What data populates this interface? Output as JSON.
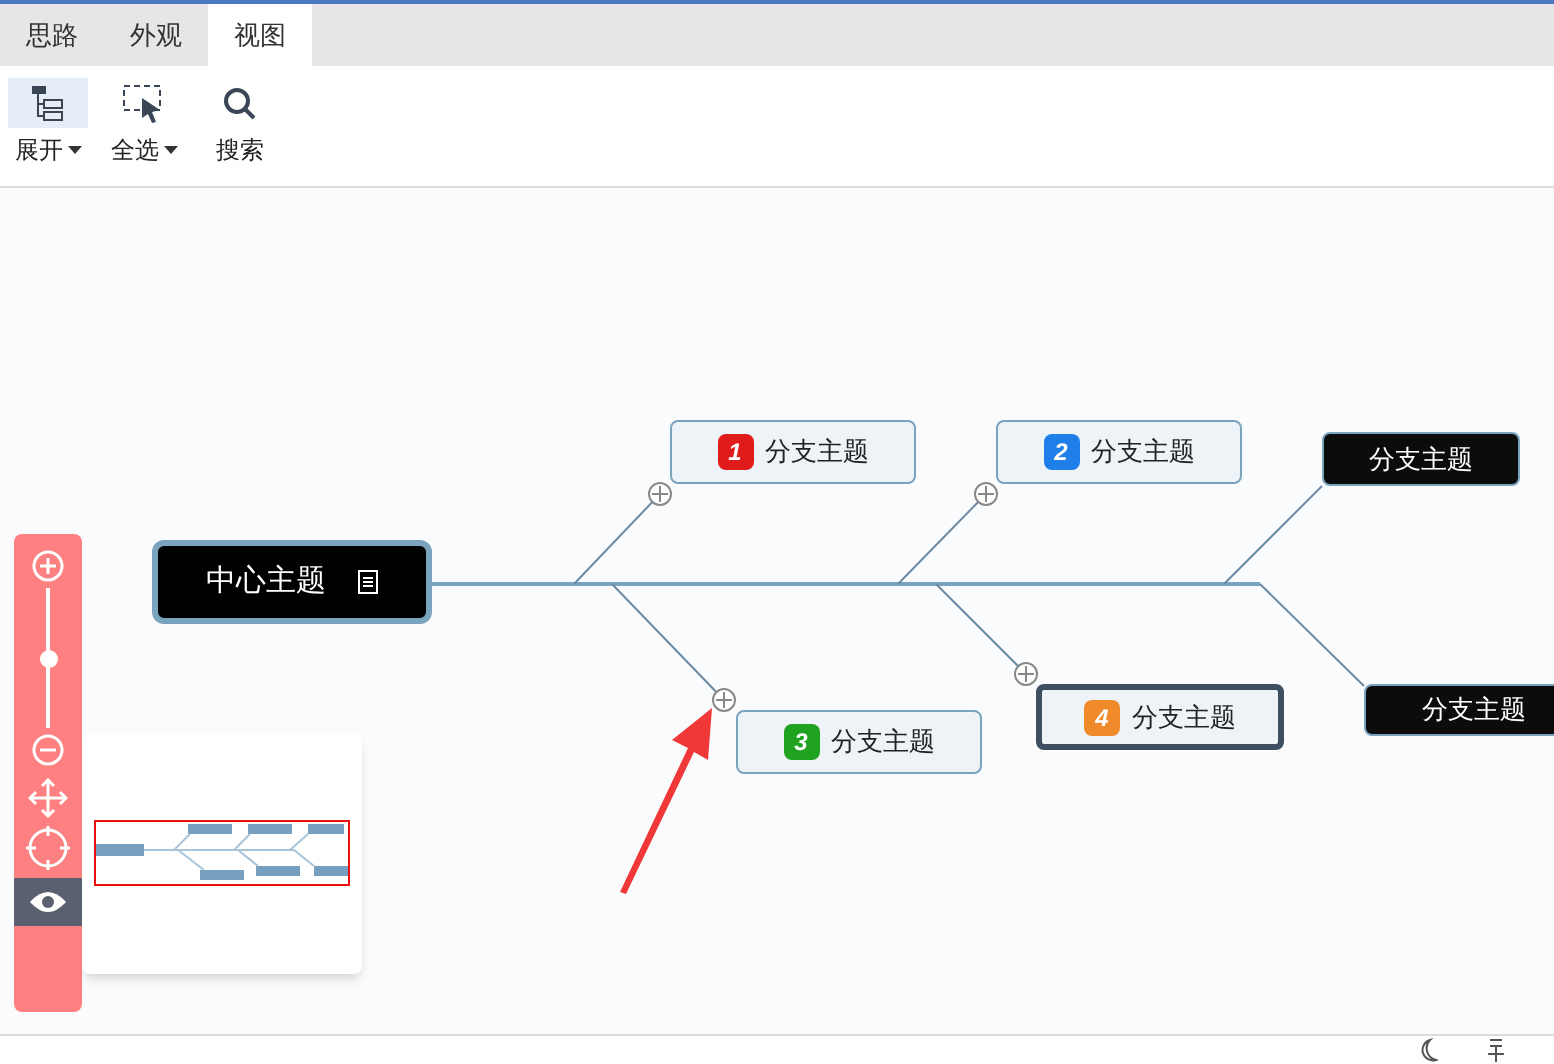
{
  "tabs": [
    {
      "label": "思路",
      "selected": false
    },
    {
      "label": "外观",
      "selected": false
    },
    {
      "label": "视图",
      "selected": true
    }
  ],
  "toolbar": [
    {
      "kind": "expand",
      "label": "展开",
      "dropdown": true,
      "selected": true
    },
    {
      "kind": "select",
      "label": "全选",
      "dropdown": true,
      "selected": false
    },
    {
      "kind": "search",
      "label": "搜索",
      "dropdown": false,
      "selected": false
    }
  ],
  "map": {
    "nodes": [
      {
        "kind": "center",
        "label": "中心主题",
        "selected": false
      },
      {
        "kind": "numbered",
        "marker": "1",
        "color": "#e01b1b",
        "label": "分支主题",
        "selected": false
      },
      {
        "kind": "numbered",
        "marker": "2",
        "color": "#1f7fe8",
        "label": "分支主题",
        "selected": false
      },
      {
        "kind": "dark",
        "label": "分支主题",
        "selected": false
      },
      {
        "kind": "numbered",
        "marker": "3",
        "color": "#1fa21f",
        "label": "分支主题",
        "selected": false
      },
      {
        "kind": "numbered",
        "marker": "4",
        "color": "#ee8a2a",
        "label": "分支主题",
        "selected": true
      },
      {
        "kind": "dark",
        "label": "分支主题",
        "selected": false
      }
    ]
  },
  "zoom": {
    "level": 0.5,
    "preview_on": true
  }
}
